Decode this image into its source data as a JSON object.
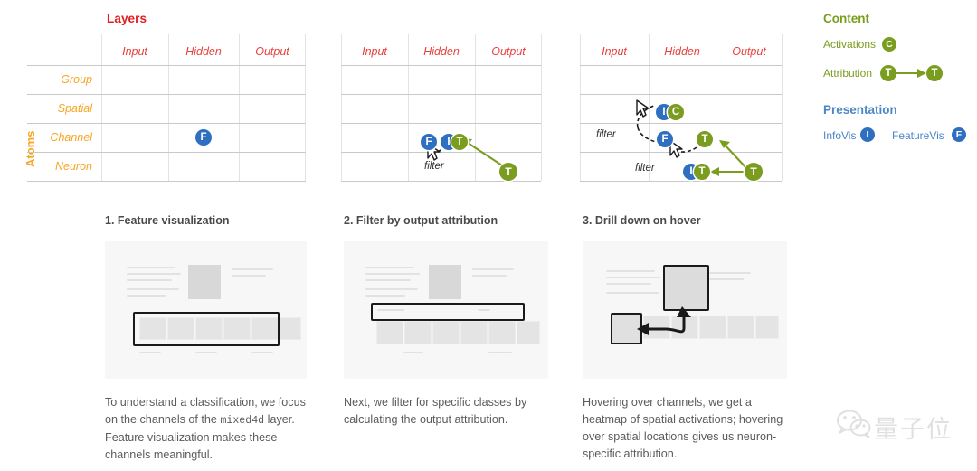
{
  "matrix": {
    "title": "Layers",
    "axis_label": "Atoms",
    "columns": [
      "Input",
      "Hidden",
      "Output"
    ],
    "rows": [
      "Group",
      "Spatial",
      "Channel",
      "Neuron"
    ],
    "filter_label": "filter",
    "panels": [
      {
        "id": "panel-1",
        "badges": [
          {
            "letter": "F",
            "color": "blue",
            "row": "Channel",
            "col": "Hidden"
          }
        ]
      },
      {
        "id": "panel-2",
        "badges": [
          {
            "letter": "F",
            "color": "blue",
            "row": "Channel",
            "col": "Hidden"
          },
          {
            "letter": "I",
            "color": "blue",
            "row": "Channel",
            "col": "Hidden"
          },
          {
            "letter": "T",
            "color": "green",
            "row": "Channel",
            "col": "Hidden"
          },
          {
            "letter": "T",
            "color": "green",
            "row": "Neuron",
            "col": "Output"
          }
        ]
      },
      {
        "id": "panel-3",
        "badges": [
          {
            "letter": "I",
            "color": "blue",
            "row": "Spatial",
            "col": "Hidden"
          },
          {
            "letter": "C",
            "color": "green",
            "row": "Spatial",
            "col": "Hidden"
          },
          {
            "letter": "F",
            "color": "blue",
            "row": "Channel",
            "col": "Hidden"
          },
          {
            "letter": "T",
            "color": "green",
            "row": "Channel",
            "col": "Output"
          },
          {
            "letter": "I",
            "color": "blue",
            "row": "Neuron",
            "col": "Output"
          },
          {
            "letter": "T",
            "color": "green",
            "row": "Neuron",
            "col": "Output"
          },
          {
            "letter": "T",
            "color": "green",
            "row": "Neuron",
            "col": "Output"
          }
        ]
      }
    ]
  },
  "legend": {
    "content": {
      "heading": "Content",
      "items": [
        {
          "label": "Activations",
          "badge": "C",
          "color": "green"
        },
        {
          "label": "Attribution",
          "badge": "T",
          "badge2": "T",
          "color": "green"
        }
      ]
    },
    "presentation": {
      "heading": "Presentation",
      "items": [
        {
          "label": "InfoVis",
          "badge": "I",
          "color": "blue"
        },
        {
          "label": "FeatureVis",
          "badge": "F",
          "color": "blue"
        }
      ]
    }
  },
  "colors": {
    "layers_title": "#e02020",
    "atoms_title": "#f6a623",
    "content": "#7a9c1f",
    "presentation": "#4a86c8",
    "badge_blue": "#2f6fc0",
    "badge_green": "#7a9c1f",
    "caption": "#5b5b5b"
  },
  "steps": [
    {
      "title": "1. Feature visualization",
      "caption_part1": "To understand a classification, we focus on the channels of the ",
      "caption_mono": "mixed4d",
      "caption_part2": " layer. Feature visualization makes these channels meaningful."
    },
    {
      "title": "2. Filter by output attribution",
      "caption_part1": "Next, we filter for specific classes by calculating the output attribution.",
      "caption_mono": "",
      "caption_part2": ""
    },
    {
      "title": "3. Drill down on hover",
      "caption_part1": "Hovering over channels, we get a heatmap of spatial activations; hovering over spatial locations gives us neuron-specific attribution.",
      "caption_mono": "",
      "caption_part2": ""
    }
  ],
  "watermark": {
    "text": "量子位",
    "icon": "wechat-icon"
  }
}
